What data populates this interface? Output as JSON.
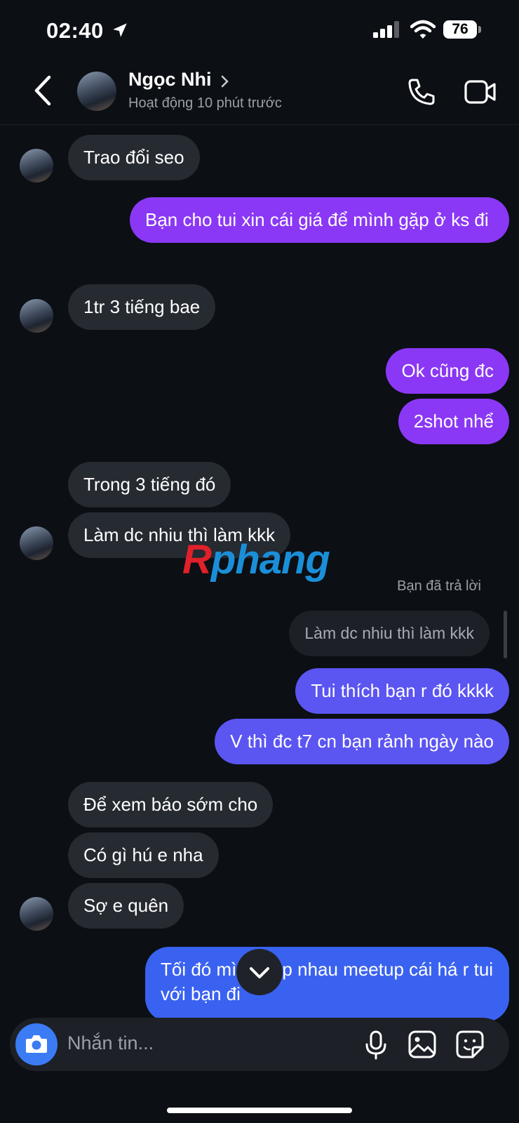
{
  "status_bar": {
    "time": "02:40",
    "battery": "76"
  },
  "header": {
    "name": "Ngọc Nhi",
    "status": "Hoạt động 10 phút trước"
  },
  "messages": {
    "m1": "Trao đổi seo",
    "m2": "Bạn cho tui xin cái giá để mình gặp ở ks đi",
    "m3": "1tr 3 tiếng bae",
    "m4": "Ok cũng đc",
    "m5": "2shot nhể",
    "m6": "Trong 3 tiếng đó",
    "m7": "Làm dc nhiu thì làm kkk",
    "reply_label": "Bạn đã trả lời",
    "reply_quote": "Làm dc nhiu thì làm kkk",
    "m8": "Tui thích bạn r đó kkkk",
    "m9": "V thì đc t7 cn bạn rảnh ngày nào",
    "m10": "Để xem báo sớm cho",
    "m11": "Có gì hú e nha",
    "m12": "Sợ e quên",
    "m13": "Tối đó mình gặp nhau meetup cái há r tui với bạn đi"
  },
  "watermark": {
    "part1": "R",
    "part2": "phang"
  },
  "composer": {
    "placeholder": "Nhắn tin..."
  },
  "colors": {
    "sent_purple": "#8a38f5",
    "sent_indigo": "#5b55f2",
    "sent_blue": "#3a62f0",
    "received": "#262a31",
    "camera_button": "#3b7cf5"
  },
  "icons": [
    "location-arrow-icon",
    "signal-icon",
    "wifi-icon",
    "battery-icon",
    "back-icon",
    "chevron-right-icon",
    "phone-icon",
    "video-camera-icon",
    "chevron-down-icon",
    "camera-icon",
    "microphone-icon",
    "gallery-icon",
    "sticker-icon"
  ]
}
